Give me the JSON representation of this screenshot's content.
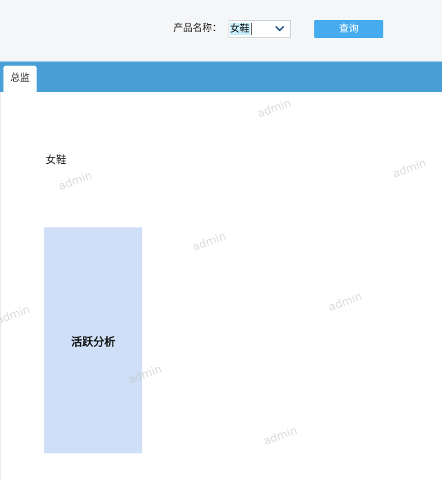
{
  "query_bar": {
    "label": "产品名称：",
    "select_value": "女鞋",
    "button_label": "查询"
  },
  "tabs": [
    {
      "label": "总监",
      "active": true
    }
  ],
  "main": {
    "product_name": "女鞋",
    "card_label": "活跃分析"
  },
  "watermark_text": "admin",
  "colors": {
    "tab_strip": "#4aa0d6",
    "button": "#47abf0",
    "card": "#cfdff8",
    "top_bar": "#f5f6f8"
  },
  "icons": {
    "select_arrow": "chevron-down-icon"
  }
}
